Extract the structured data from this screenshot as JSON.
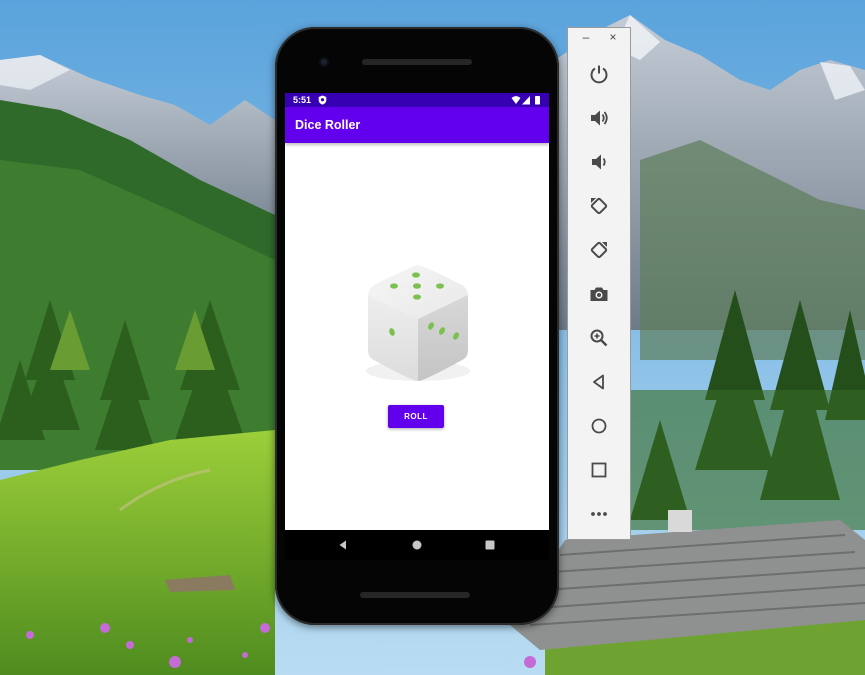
{
  "phone": {
    "status_bar": {
      "time": "5:51"
    },
    "app_bar": {
      "title": "Dice Roller"
    },
    "main": {
      "dice_face_value": 5,
      "roll_button": "ROLL"
    },
    "nav_bar": {
      "buttons": [
        "back-icon",
        "home-icon",
        "recents-icon"
      ]
    }
  },
  "emulator_panel": {
    "window_controls": {
      "minimize": "–",
      "close": "×"
    },
    "tools": [
      "power-icon",
      "volume-up-icon",
      "volume-down-icon",
      "rotate-left-icon",
      "rotate-right-icon",
      "camera-icon",
      "zoom-icon",
      "back-icon",
      "home-icon",
      "overview-icon",
      "more-icon"
    ]
  },
  "colors": {
    "primary": "#6200ee",
    "primary_dark": "#3700b3",
    "dice_pip": "#7cc04f"
  }
}
